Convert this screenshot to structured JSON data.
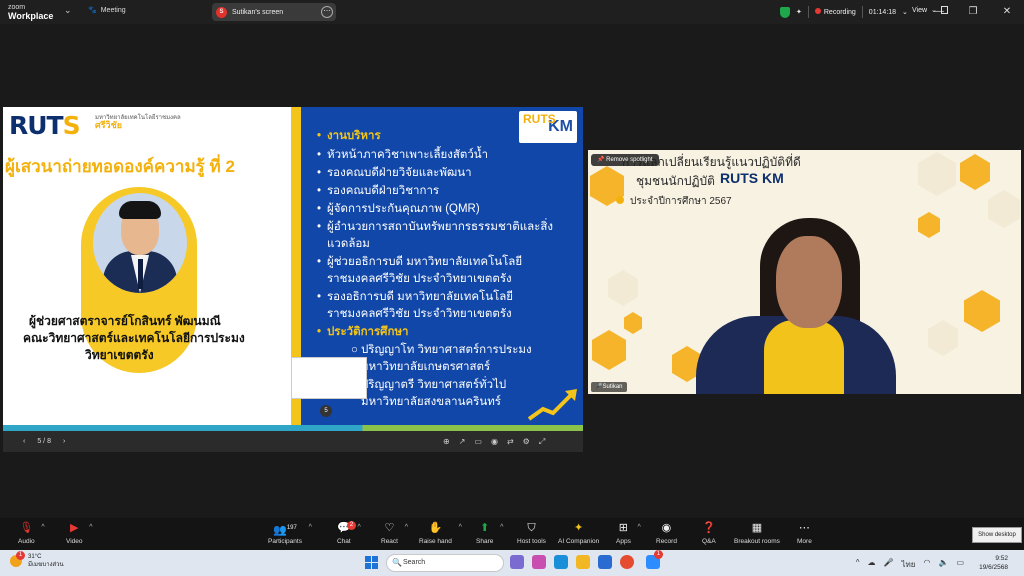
{
  "app": {
    "brand_line1": "zoom",
    "brand_line2": "Workplace",
    "meeting_label": "Meeting",
    "share_tab_label": "Sutikan's screen",
    "share_tab_initial": "S",
    "recording_label": "Recording",
    "timer": "01:14:18",
    "view_label": "View"
  },
  "slide": {
    "logo_main": "RUT",
    "logo_s": "S",
    "logo_sub1": "มหาวิทยาลัยเทคโนโลยีราชมงคล",
    "logo_sub2": "ศรีวิชัย",
    "title": "ผู้เสวนาถ่ายทอดองค์ความรู้ ที่ 2",
    "name_line1": "ผู้ช่วยศาสตราจารย์โกสินทร์  พัฒนมณี",
    "name_line2": "คณะวิทยาศาสตร์และเทคโนโลยีการประมง",
    "name_line3": "วิทยาเขตตรัง",
    "km_logo": "KM",
    "km_small": "RUTS",
    "bullets": [
      "งานบริหาร",
      "หัวหน้าภาควิชาเพาะเลี้ยงสัตว์น้ำ",
      "รองคณบดีฝ่ายวิจัยและพัฒนา",
      "รองคณบดีฝ่ายวิชาการ",
      "ผู้จัดการประกันคุณภาพ (QMR)",
      "ผู้อำนวยการสถาบันทรัพยากรธรรมชาติและสิ่ง",
      "แวดล้อม",
      "ผู้ช่วยอธิการบดี มหาวิทยาลัยเทคโนโลยี",
      "ราชมงคลศรีวิชัย ประจำวิทยาเขตตรัง",
      "รองอธิการบดี มหาวิทยาลัยเทคโนโลยี",
      "ราชมงคลศรีวิชัย ประจำวิทยาเขตตรัง",
      "ประวัติการศึกษา",
      "ปริญญาโท วิทยาศาสตร์การประมง",
      "มหาวิทยาลัยเกษตรศาสตร์",
      "ปริญญาตรี วิทยาศาสตร์ทั่วไป",
      "มหาวิทยาลัยสงขลานครินทร์"
    ],
    "thumb_number": "5"
  },
  "share_controls": {
    "page_indicator": "5 / 8",
    "prev": "‹",
    "next": "›"
  },
  "video": {
    "spotlight_label": "Remove spotlight",
    "banner_line1": "การแลกเปลี่ยนเรียนรู้แนวปฏิบัติที่ดี",
    "banner_line2": "ชุมชนนักปฏิบัติ",
    "banner_logo": "RUTS KM",
    "banner_year": "ประจำปีการศึกษา 2567",
    "participant_name": "Sutikan"
  },
  "toolbar": {
    "audio": "Audio",
    "video": "Video",
    "participants": "Participants",
    "participants_count": "197",
    "chat": "Chat",
    "chat_badge": "2",
    "react": "React",
    "raise_hand": "Raise hand",
    "share": "Share",
    "host_tools": "Host tools",
    "ai_companion": "AI Companion",
    "apps": "Apps",
    "record": "Record",
    "qa": "Q&A",
    "breakout": "Breakout rooms",
    "more": "More",
    "show_desktop": "Show desktop"
  },
  "taskbar": {
    "weather_temp": "31°C",
    "weather_desc": "มีเมฆบางส่วน",
    "search_placeholder": "Search",
    "lang": "ไทย",
    "time": "9:52",
    "date": "19/6/2568",
    "zoom_badge": "1",
    "weather_badge": "1"
  },
  "colors": {
    "accent_yellow": "#f3c419",
    "slide_blue": "#1147a8",
    "record_red": "#e53935",
    "share_green": "#1ea84b"
  }
}
